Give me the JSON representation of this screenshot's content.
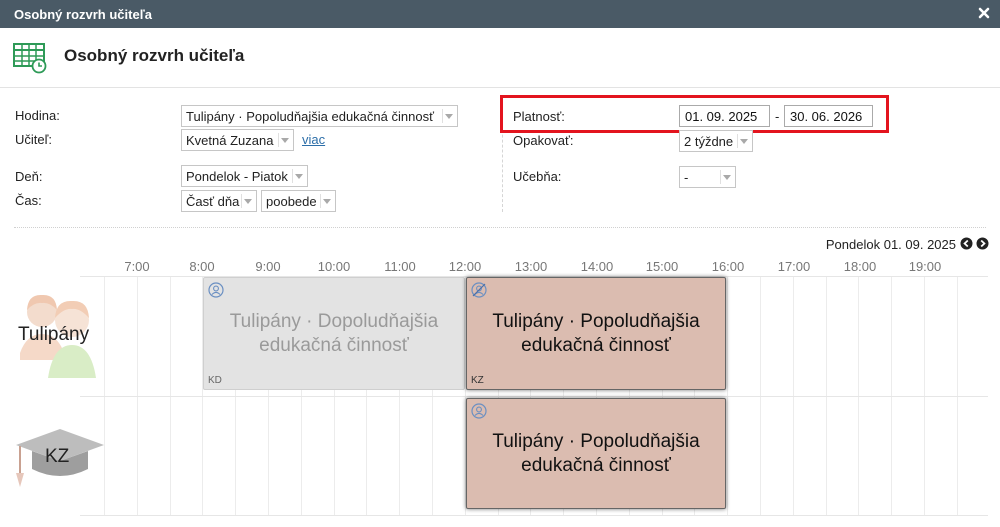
{
  "window": {
    "title": "Osobný rozvrh učiteľa"
  },
  "header": {
    "title": "Osobný rozvrh učiteľa"
  },
  "form": {
    "hodina": {
      "label": "Hodina:",
      "value": "Tulipány · Popoludňajšia edukačná činnosť"
    },
    "ucitel": {
      "label": "Učiteľ:",
      "value": "Kvetná Zuzana",
      "more_link": "viac"
    },
    "den": {
      "label": "Deň:",
      "value": "Pondelok - Piatok"
    },
    "cas": {
      "label": "Čas:",
      "value1": "Časť dňa",
      "value2": "poobede"
    },
    "platnost": {
      "label": "Platnosť:",
      "from": "01. 09. 2025",
      "dash": "-",
      "to": "30. 06. 2026"
    },
    "opakovat": {
      "label": "Opakovať:",
      "value": "2 týždne"
    },
    "ucebna": {
      "label": "Učebňa:",
      "value": "-"
    }
  },
  "timeline": {
    "date_label": "Pondelok 01. 09. 2025",
    "hours": [
      "7:00",
      "8:00",
      "9:00",
      "10:00",
      "11:00",
      "12:00",
      "13:00",
      "14:00",
      "15:00",
      "16:00",
      "17:00",
      "18:00",
      "19:00"
    ],
    "rows": [
      {
        "label": "Tulipány"
      },
      {
        "label": "KZ"
      }
    ],
    "events": [
      {
        "text": "Tulipány · Dopoludňajšia edukačná činnosť",
        "initials": "KD",
        "style": "gray"
      },
      {
        "text": "Tulipány · Popoludňajšia edukačná činnosť",
        "initials": "KZ",
        "style": "pink"
      },
      {
        "text": "Tulipány · Popoludňajšia edukačná činnosť",
        "initials": "",
        "style": "pink"
      }
    ]
  },
  "colors": {
    "titlebar": "#4a5a66",
    "highlight_border": "#e3141e",
    "event_pink": "#dbbcb0",
    "event_gray": "#e3e3e3",
    "icon_green": "#2e9a57"
  },
  "icons": {
    "header": "timetable-icon",
    "close": "close-icon",
    "prev": "arrow-left-icon",
    "next": "arrow-right-icon"
  }
}
